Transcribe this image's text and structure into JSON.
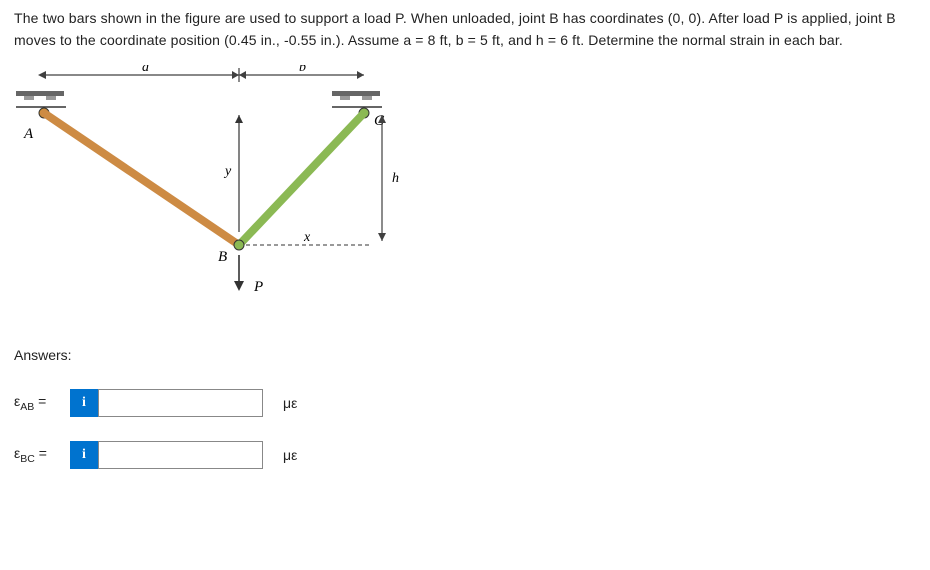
{
  "problem": "The two bars shown in the figure are used to support a load P. When unloaded, joint B has coordinates (0, 0). After load P is applied, joint B moves to the coordinate position (0.45 in., -0.55 in.). Assume a = 8 ft, b = 5 ft, and h = 6 ft. Determine the normal strain in each bar.",
  "figure": {
    "labels": {
      "a": "a",
      "b": "b",
      "A": "A",
      "B": "B",
      "C": "C",
      "x": "x",
      "y": "y",
      "h": "h",
      "P": "P"
    }
  },
  "answers_heading": "Answers:",
  "answers": [
    {
      "label_prefix": "ε",
      "label_sub": "AB",
      "label_suffix": " =",
      "value": "",
      "unit": "με"
    },
    {
      "label_prefix": "ε",
      "label_sub": "BC",
      "label_suffix": " =",
      "value": "",
      "unit": "με"
    }
  ],
  "info_icon": "i"
}
